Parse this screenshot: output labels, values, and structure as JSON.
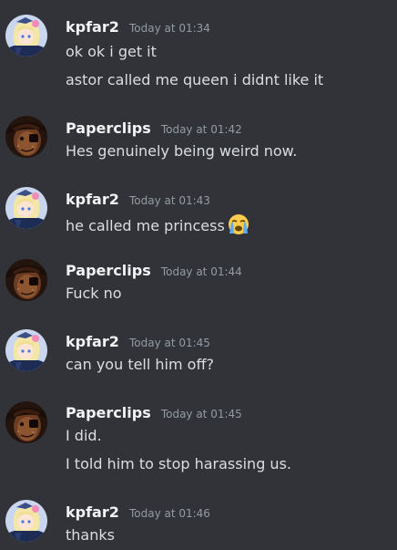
{
  "messages": [
    {
      "user": "kpfar2",
      "time": "Today at 01:34",
      "avatar": "blonde-anime-girl-avatar",
      "lines": [
        "ok ok i get it",
        "astor called me queen i didnt like it"
      ]
    },
    {
      "user": "Paperclips",
      "time": "Today at 01:42",
      "avatar": "dark-hat-figure-avatar",
      "lines": [
        "Hes genuinely being weird now."
      ]
    },
    {
      "user": "kpfar2",
      "time": "Today at 01:43",
      "avatar": "blonde-anime-girl-avatar",
      "lines": [
        "he called me princess"
      ],
      "emoji": "loudly-crying-face-emoji"
    },
    {
      "user": "Paperclips",
      "time": "Today at 01:44",
      "avatar": "dark-hat-figure-avatar",
      "lines": [
        "Fuck no"
      ]
    },
    {
      "user": "kpfar2",
      "time": "Today at 01:45",
      "avatar": "blonde-anime-girl-avatar",
      "lines": [
        "can you tell him off?"
      ]
    },
    {
      "user": "Paperclips",
      "time": "Today at 01:45",
      "avatar": "dark-hat-figure-avatar",
      "lines": [
        "I did.",
        "I told him to stop harassing us."
      ]
    },
    {
      "user": "kpfar2",
      "time": "Today at 01:46",
      "avatar": "blonde-anime-girl-avatar",
      "lines": [
        "thanks"
      ]
    }
  ],
  "colors": {
    "background": "#313338",
    "username": "#f2f3f5",
    "timestamp": "#949ba4",
    "message_text": "#dbdee1"
  }
}
